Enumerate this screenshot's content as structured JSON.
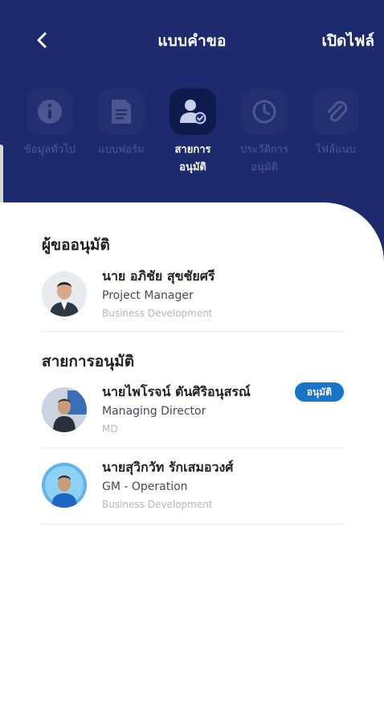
{
  "header": {
    "title": "แบบคำขอ",
    "open_file_label": "เปิดไฟล์"
  },
  "steps": [
    {
      "line1": "ข้อมูลทั่วไป",
      "line2": "",
      "icon": "info-icon",
      "active": false
    },
    {
      "line1": "แบบฟอร์ม",
      "line2": "",
      "icon": "document-icon",
      "active": false
    },
    {
      "line1": "สายการ",
      "line2": "อนุมัติ",
      "icon": "user-check-icon",
      "active": true
    },
    {
      "line1": "ประวัติการ",
      "line2": "อนุมัติ",
      "icon": "clock-history-icon",
      "active": false
    },
    {
      "line1": "ไฟล์แนบ",
      "line2": "",
      "icon": "paperclip-icon",
      "active": false
    }
  ],
  "requester_section": {
    "title": "ผู้ขออนุมัติ",
    "person": {
      "name": "นาย อภิชัย สุขชัยศรี",
      "role": "Project Manager",
      "department": "Business Development"
    }
  },
  "approval_section": {
    "title": "สายการอนุมัติ",
    "people": [
      {
        "name": "นายไพโรจน์ ตันศิริอนุสรณ์",
        "role": "Managing Director",
        "department": "MD",
        "badge": "อนุมัติ"
      },
      {
        "name": "นายสุวิกวัท รักเสมอวงศ์",
        "role": "GM - Operation",
        "department": "Business Development",
        "badge": ""
      }
    ]
  },
  "colors": {
    "header_bg": "#1d2a6e",
    "badge_bg": "#1b73c7",
    "text_primary": "#222222"
  }
}
